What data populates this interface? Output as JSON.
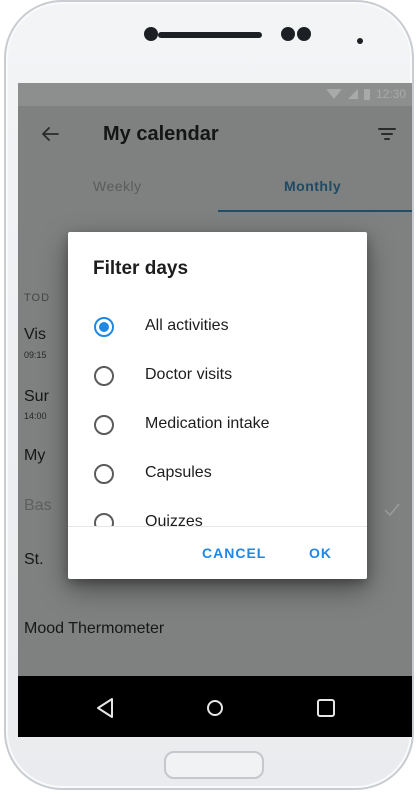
{
  "status_bar": {
    "time": "12:30"
  },
  "appbar": {
    "title": "My calendar"
  },
  "tabs": [
    {
      "label": "Weekly",
      "selected": false
    },
    {
      "label": "Monthly",
      "selected": true
    }
  ],
  "list": {
    "section_label": "TOD",
    "items": [
      {
        "label": "Vis",
        "time": "09:15"
      },
      {
        "label": "Sur",
        "time": "14:00"
      },
      {
        "label": "My"
      },
      {
        "label": "Bas"
      },
      {
        "label": "St."
      },
      {
        "label": "Mood Thermometer"
      }
    ]
  },
  "dialog": {
    "title": "Filter days",
    "options": [
      {
        "label": "All activities",
        "selected": true
      },
      {
        "label": "Doctor visits",
        "selected": false
      },
      {
        "label": "Medication intake",
        "selected": false
      },
      {
        "label": "Capsules",
        "selected": false
      },
      {
        "label": "Quizzes",
        "selected": false
      }
    ],
    "cancel_label": "CANCEL",
    "ok_label": "OK"
  },
  "icons": {
    "back": "back-arrow-icon",
    "filter": "filter-icon",
    "check": "check-icon",
    "nav_back": "triangle-back-icon",
    "nav_home": "circle-home-icon",
    "nav_recents": "square-recents-icon"
  },
  "colors": {
    "accent": "#1e88e5",
    "scrim": "#7f8080",
    "tab_selected": "#1e4a62",
    "nav_bar": "#000000"
  }
}
